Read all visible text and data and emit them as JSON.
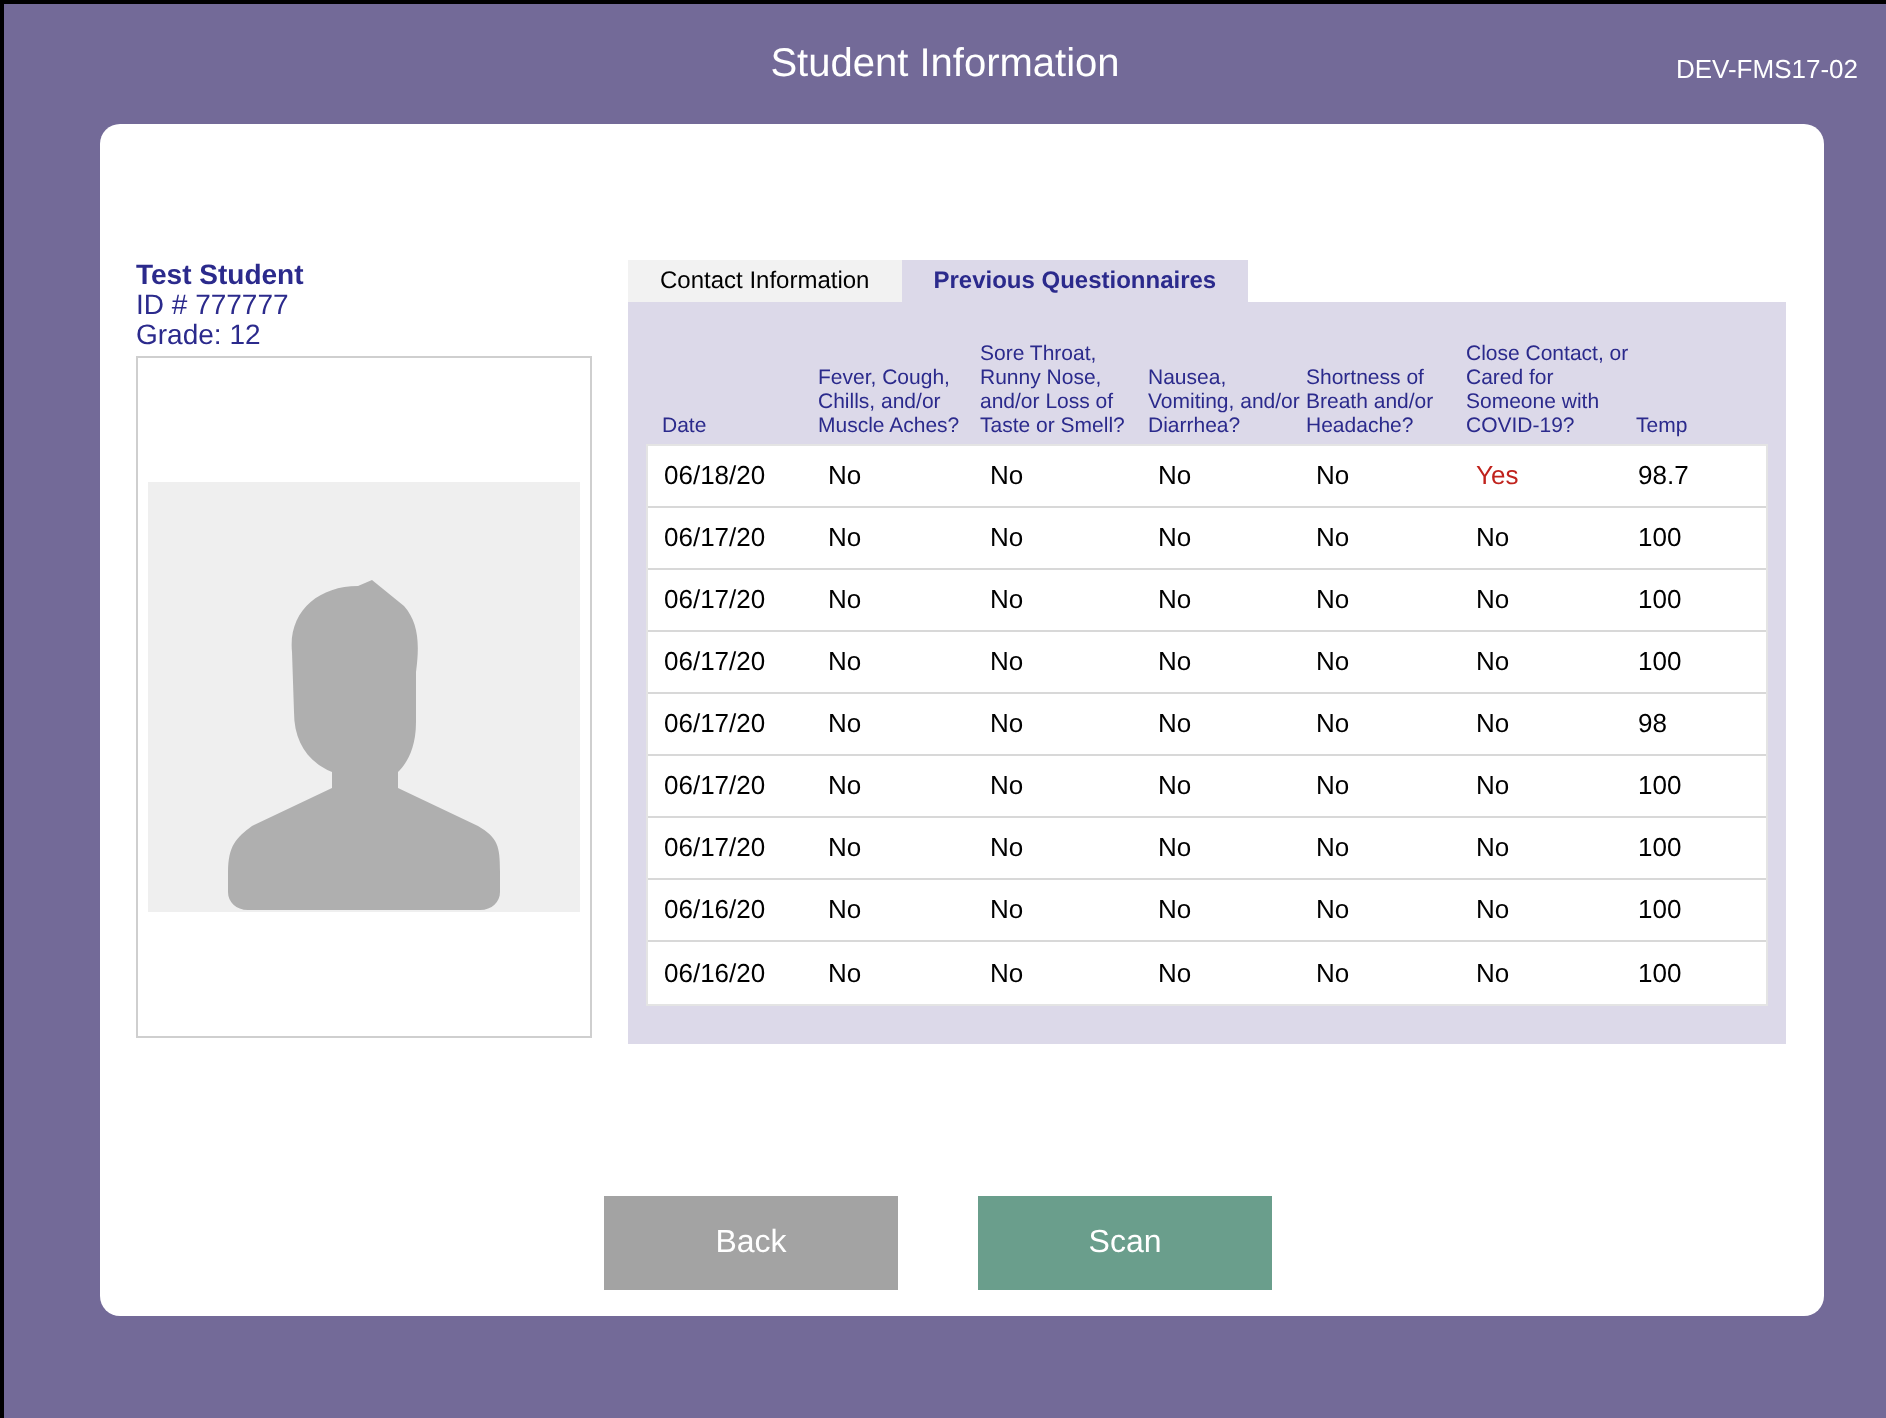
{
  "header": {
    "title": "Student Information",
    "device": "DEV-FMS17-02"
  },
  "student": {
    "name": "Test Student",
    "id": "ID # 777777",
    "grade": "Grade: 12"
  },
  "tabs": [
    {
      "label": "Contact Information",
      "selected": false
    },
    {
      "label": "Previous Questionnaires",
      "selected": true
    }
  ],
  "table": {
    "columns": [
      "Date",
      "Fever, Cough, Chills, and/or Muscle Aches?",
      "Sore Throat, Runny Nose, and/or Loss of Taste or Smell?",
      "Nausea, Vomiting, and/or Diarrhea?",
      "Shortness of Breath and/or Headache?",
      "Close Contact, or Cared for Someone with COVID-19?",
      "Temp"
    ],
    "rows": [
      {
        "cells": [
          {
            "text": "06/18/20",
            "flagged": false
          },
          {
            "text": "No",
            "flagged": false
          },
          {
            "text": "No",
            "flagged": false
          },
          {
            "text": "No",
            "flagged": false
          },
          {
            "text": "No",
            "flagged": false
          },
          {
            "text": "Yes",
            "flagged": true
          },
          {
            "text": "98.7",
            "flagged": false
          }
        ]
      },
      {
        "cells": [
          {
            "text": "06/17/20",
            "flagged": false
          },
          {
            "text": "No",
            "flagged": false
          },
          {
            "text": "No",
            "flagged": false
          },
          {
            "text": "No",
            "flagged": false
          },
          {
            "text": "No",
            "flagged": false
          },
          {
            "text": "No",
            "flagged": false
          },
          {
            "text": "100",
            "flagged": false
          }
        ]
      },
      {
        "cells": [
          {
            "text": "06/17/20",
            "flagged": false
          },
          {
            "text": "No",
            "flagged": false
          },
          {
            "text": "No",
            "flagged": false
          },
          {
            "text": "No",
            "flagged": false
          },
          {
            "text": "No",
            "flagged": false
          },
          {
            "text": "No",
            "flagged": false
          },
          {
            "text": "100",
            "flagged": false
          }
        ]
      },
      {
        "cells": [
          {
            "text": "06/17/20",
            "flagged": false
          },
          {
            "text": "No",
            "flagged": false
          },
          {
            "text": "No",
            "flagged": false
          },
          {
            "text": "No",
            "flagged": false
          },
          {
            "text": "No",
            "flagged": false
          },
          {
            "text": "No",
            "flagged": false
          },
          {
            "text": "100",
            "flagged": false
          }
        ]
      },
      {
        "cells": [
          {
            "text": "06/17/20",
            "flagged": false
          },
          {
            "text": "No",
            "flagged": false
          },
          {
            "text": "No",
            "flagged": false
          },
          {
            "text": "No",
            "flagged": false
          },
          {
            "text": "No",
            "flagged": false
          },
          {
            "text": "No",
            "flagged": false
          },
          {
            "text": "98",
            "flagged": false
          }
        ]
      },
      {
        "cells": [
          {
            "text": "06/17/20",
            "flagged": false
          },
          {
            "text": "No",
            "flagged": false
          },
          {
            "text": "No",
            "flagged": false
          },
          {
            "text": "No",
            "flagged": false
          },
          {
            "text": "No",
            "flagged": false
          },
          {
            "text": "No",
            "flagged": false
          },
          {
            "text": "100",
            "flagged": false
          }
        ]
      },
      {
        "cells": [
          {
            "text": "06/17/20",
            "flagged": false
          },
          {
            "text": "No",
            "flagged": false
          },
          {
            "text": "No",
            "flagged": false
          },
          {
            "text": "No",
            "flagged": false
          },
          {
            "text": "No",
            "flagged": false
          },
          {
            "text": "No",
            "flagged": false
          },
          {
            "text": "100",
            "flagged": false
          }
        ]
      },
      {
        "cells": [
          {
            "text": "06/16/20",
            "flagged": false
          },
          {
            "text": "No",
            "flagged": false
          },
          {
            "text": "No",
            "flagged": false
          },
          {
            "text": "No",
            "flagged": false
          },
          {
            "text": "No",
            "flagged": false
          },
          {
            "text": "No",
            "flagged": false
          },
          {
            "text": "100",
            "flagged": false
          }
        ]
      },
      {
        "cells": [
          {
            "text": "06/16/20",
            "flagged": false
          },
          {
            "text": "No",
            "flagged": false
          },
          {
            "text": "No",
            "flagged": false
          },
          {
            "text": "No",
            "flagged": false
          },
          {
            "text": "No",
            "flagged": false
          },
          {
            "text": "No",
            "flagged": false
          },
          {
            "text": "100",
            "flagged": false
          }
        ]
      }
    ]
  },
  "buttons": [
    {
      "label": "Back",
      "kind": "secondary"
    },
    {
      "label": "Scan",
      "kind": "primary"
    }
  ]
}
